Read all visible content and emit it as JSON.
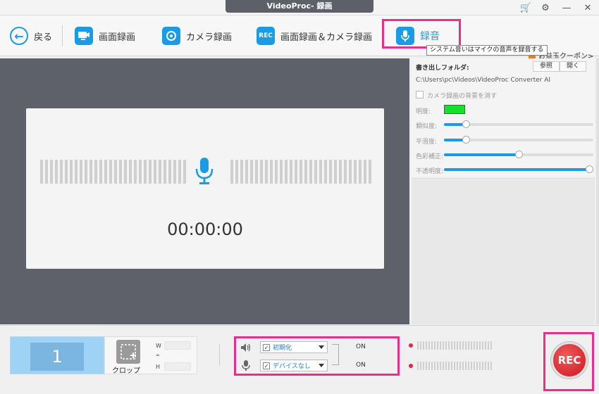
{
  "window": {
    "title": "VideoProc- 録画"
  },
  "toolbar": {
    "back_label": "戻る",
    "screen_rec_label": "画面録画",
    "camera_rec_label": "カメラ録画",
    "screen_camera_label": "画面録画＆カメラ録画",
    "audio_rec_label": "録音",
    "rec_icon_text": "REC",
    "tooltip": "システム音いはマイクの音声を録音する",
    "coupon": "お益玉クーポン>"
  },
  "preview": {
    "timer": "00:00:00"
  },
  "panel": {
    "export_folder_label": "書き出しフォルダ:",
    "browse_button": "参照",
    "open_button": "開く",
    "path": "C:\\Users\\pc\\Videos\\VideoProc Converter AI",
    "remove_bg_label": "カメラ録画の背景を消す",
    "brightness_label": "明度:",
    "similarity_label": "類似度:",
    "smoothness_label": "平滑度:",
    "color_correction_label": "色彩補正:",
    "opacity_label": "不透明度:",
    "key_color": "#16e02a",
    "similarity_value": 0.15,
    "smoothness_value": 0.15,
    "color_correction_value": 0.5,
    "opacity_value": 1.0
  },
  "bottom": {
    "screen_number": "1",
    "crop_label": "クロップ",
    "w_label": "W",
    "h_label": "H",
    "speaker_device": "初期化",
    "mic_device": "デバイスなし",
    "speaker_state": "ON",
    "mic_state": "ON",
    "rec_button": "REC",
    "checkmark": "✓"
  },
  "colors": {
    "accent": "#1a9be6",
    "highlight": "#e6308a",
    "rec": "#d21f26"
  }
}
